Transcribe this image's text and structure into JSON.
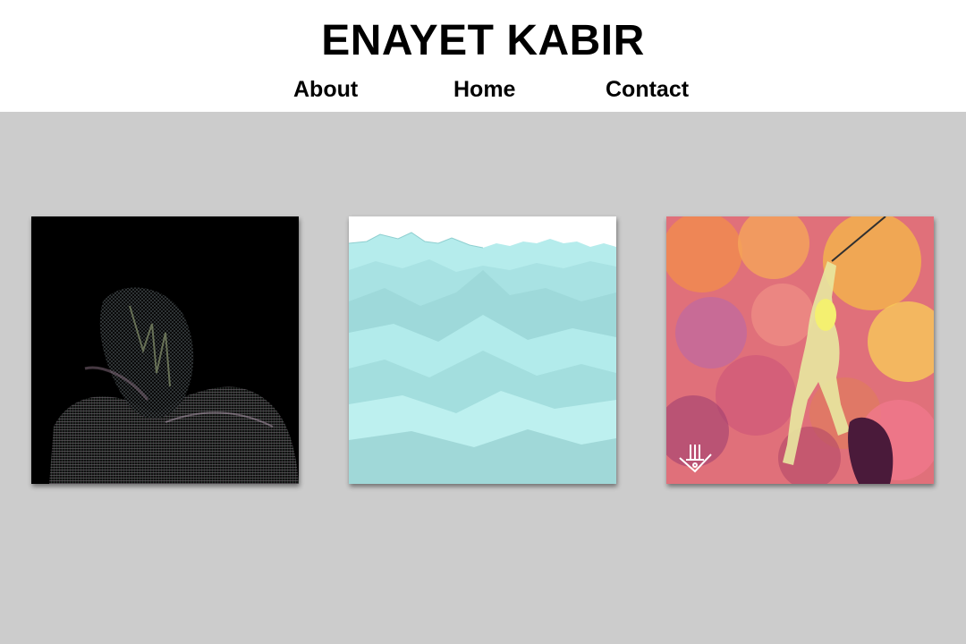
{
  "site": {
    "title": "ENAYET KABIR"
  },
  "nav": [
    {
      "label": "About"
    },
    {
      "label": "Home"
    },
    {
      "label": "Contact"
    }
  ],
  "gallery": [
    {
      "subject": "dark textured figure artwork",
      "colors": {
        "bg": "#000000",
        "accent": "#8fa2a5"
      }
    },
    {
      "subject": "low-poly aqua terrain artwork",
      "colors": {
        "bg": "#ffffff",
        "accent": "#a9e6e6"
      }
    },
    {
      "subject": "colorful figure on rope artwork",
      "colors": {
        "bg": "#d86a6f",
        "accent": "#f0a050"
      }
    }
  ],
  "theme": {
    "header_bg": "#ffffff",
    "page_bg": "#cccccc",
    "text": "#000000"
  }
}
